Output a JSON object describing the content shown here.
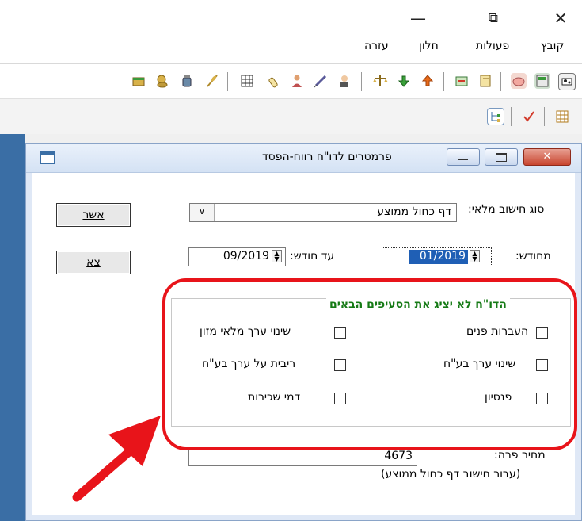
{
  "window_controls": {
    "minimize": "—",
    "restore": "⧉",
    "close": "✕"
  },
  "menu": {
    "items": [
      "קובץ",
      "פעולות",
      "חלון",
      "עזרה"
    ]
  },
  "toolbar": {
    "icons": [
      "cow-icon",
      "calc-icon",
      "pig-icon",
      "sep",
      "notebook-icon",
      "export-icon",
      "sep",
      "upload-icon",
      "download-icon",
      "scale-icon",
      "sep",
      "farmer-icon",
      "syringe-icon",
      "person-icon",
      "bottle-icon",
      "grid-icon",
      "sep",
      "wheat-icon",
      "jar-icon",
      "coins-icon",
      "books-icon"
    ],
    "colors": {
      "accent": "#d9b24a",
      "green": "#3a9a3a",
      "red": "#d23a2a",
      "blue": "#3a6ea5"
    }
  },
  "toolbar2": {
    "icons": [
      "grid-icon",
      "check-icon",
      "tree-icon"
    ]
  },
  "dialog": {
    "title": "פרמטרים לדו\"ח רווח-הפסד",
    "calc_type_label": "סוג חישוב מלאי:",
    "calc_type_value": "דף כחול ממוצע",
    "from_month_label": "מחודש:",
    "from_month_value": "01/2019",
    "to_month_label": "עד חודש:",
    "to_month_value": "09/2019",
    "ok_button": "אשר",
    "exit_button": "צא",
    "group_title": "הדו\"ח לא יציג את הסעיפים הבאים",
    "checkboxes": {
      "internal_transfers": "העברות פנים",
      "value_change_livestock": "שינוי ערך בע\"ח",
      "pension": "פנסיון",
      "value_change_feed": "שינוי ערך מלאי מזון",
      "interest_livestock": "ריבית על ערך בע\"ח",
      "rent": "דמי שכירות"
    },
    "cow_price_label": "מחיר פרה:",
    "cow_price_value": "4673",
    "cow_price_note": "(עבור חישוב דף כחול ממוצע)"
  },
  "annotation": {
    "highlight_color": "#e8141a"
  }
}
